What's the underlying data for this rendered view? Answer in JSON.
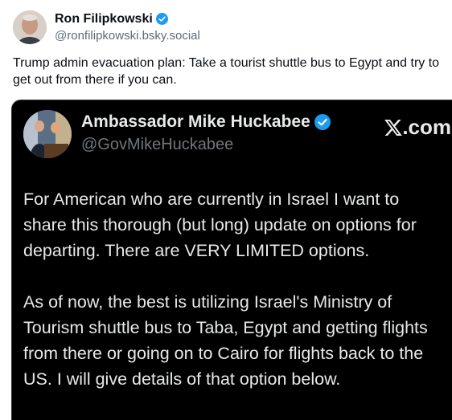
{
  "post": {
    "author_name": "Ron Filipkowski",
    "author_handle": "@ronfilipkowski.bsky.social",
    "text": "Trump admin evacuation plan: Take a tourist shuttle bus to Egypt and try to get out from there if you can."
  },
  "embed": {
    "author_name": "Ambassador Mike Huckabee",
    "author_handle": "@GovMikeHuckabee",
    "brand": ".com",
    "paragraphs": [
      "For American who are currently in Israel I want to share this thorough (but long) update on options for departing.  There are VERY LIMITED options.",
      "As of now, the best is utilizing Israel's Ministry of Tourism shuttle bus to Taba, Egypt and getting flights from there or going on to Cairo for flights back to the US. I will give details of that option below."
    ]
  },
  "colors": {
    "verified": "#1d9bf0",
    "embed_bg": "#000000"
  },
  "icons": [
    "verified-badge-icon",
    "x-logo-icon"
  ]
}
